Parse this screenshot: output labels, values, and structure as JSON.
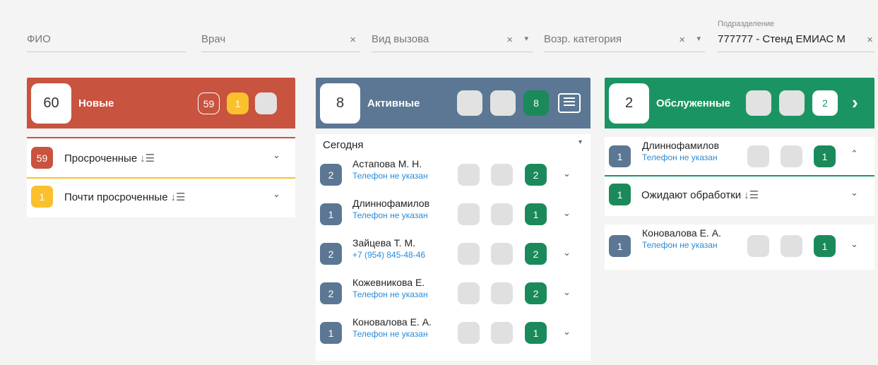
{
  "filters": {
    "fio": "ФИО",
    "doctor": "Врач",
    "call_type": "Вид вызова",
    "age_category": "Возр. категория",
    "department_label": "Подразделение",
    "department_value": "777777 - Стенд ЕМИАС М",
    "clear": "×",
    "caret": "▾"
  },
  "columns": {
    "new": {
      "count": "60",
      "title": "Новые",
      "b1": "59",
      "b2": "1",
      "color": "#c8533f",
      "groups": [
        {
          "count": "59",
          "label": "Просроченные"
        },
        {
          "count": "1",
          "label": "Почти просроченные"
        }
      ]
    },
    "active": {
      "count": "8",
      "title": "Активные",
      "b3": "8",
      "color": "#5b7793",
      "group_label": "Сегодня",
      "items": [
        {
          "count": "2",
          "name": "Астапова М. Н.",
          "phone": "Телефон не указан",
          "num": "2"
        },
        {
          "count": "1",
          "name": "Длиннофамилов",
          "phone": "Телефон не указан",
          "num": "1"
        },
        {
          "count": "2",
          "name": "Зайцева Т. М.",
          "phone": "+7 (954) 845-48-46",
          "num": "2"
        },
        {
          "count": "2",
          "name": "Кожевникова Е.",
          "phone": "Телефон не указан",
          "num": "2"
        },
        {
          "count": "1",
          "name": "Коновалова Е. А.",
          "phone": "Телефон не указан",
          "num": "1"
        }
      ]
    },
    "served": {
      "count": "2",
      "title": "Обслуженные",
      "b3": "2",
      "color": "#1b9463",
      "top_item": {
        "count": "1",
        "name": "Длиннофамилов",
        "phone": "Телефон не указан",
        "num": "1"
      },
      "group": {
        "count": "1",
        "label": "Ожидают обработки"
      },
      "item": {
        "count": "1",
        "name": "Коновалова Е. А.",
        "phone": "Телефон не указан",
        "num": "1"
      }
    }
  },
  "icons": {
    "chevron_down": "⌄",
    "chevron_up": "⌃",
    "chevron_right": "›",
    "sort": "↓☰",
    "print": "🖶"
  }
}
